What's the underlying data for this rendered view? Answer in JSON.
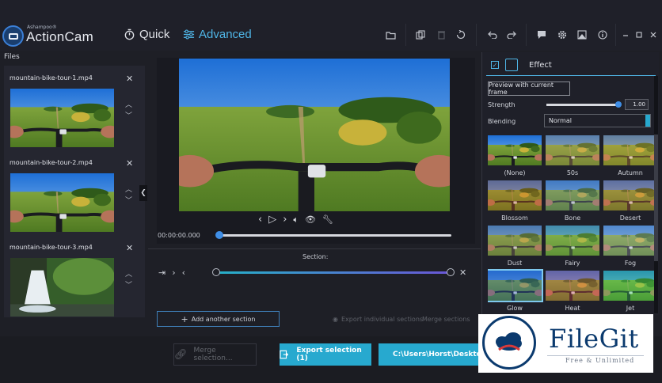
{
  "app": {
    "brand": "Ashampoo®",
    "name": "ActionCam"
  },
  "modes": [
    {
      "label": "Quick",
      "icon": "stopwatch-icon",
      "active": false
    },
    {
      "label": "Advanced",
      "icon": "sliders-icon",
      "active": true
    }
  ],
  "toolbar_icons": [
    "folder-icon",
    "copy-icon",
    "trash-icon",
    "reset-icon",
    "undo-icon",
    "redo-icon",
    "chat-icon",
    "gear-icon",
    "image-icon",
    "info-icon",
    "minimize-icon",
    "maximize-icon",
    "close-icon"
  ],
  "files": {
    "title": "Files",
    "items": [
      {
        "name": "mountain-bike-tour-1.mp4"
      },
      {
        "name": "mountain-bike-tour-2.mp4"
      },
      {
        "name": "mountain-bike-tour-3.mp4"
      }
    ]
  },
  "player": {
    "timecode": "00:00:00.000",
    "progress": 0.0
  },
  "section": {
    "label": "Section:",
    "add_label": "Add another section",
    "export_individual": "Export individual sections",
    "merge_sections": "Merge sections"
  },
  "bottom": {
    "merge_label": "Merge selection...",
    "export_label": "Export selection (1)",
    "path_label": "C:\\Users\\Horst\\Desktop"
  },
  "effect": {
    "title": "Effect",
    "preview_label": "Preview with current frame",
    "strength_label": "Strength",
    "strength_value": "1.00",
    "strength": 1.0,
    "blending_label": "Blending",
    "blending_value": "Normal",
    "presets": [
      "(None)",
      "50s",
      "Autumn",
      "Blossom",
      "Bone",
      "Desert",
      "Dust",
      "Fairy",
      "Fog",
      "Glow",
      "Heat",
      "Jet"
    ],
    "selected": "Glow"
  },
  "watermark": {
    "title": "FileGit",
    "subtitle": "Free & Unlimited"
  },
  "colors": {
    "accent": "#27a9cf",
    "blue": "#3f8ee6",
    "bg": "#1e1f26"
  }
}
